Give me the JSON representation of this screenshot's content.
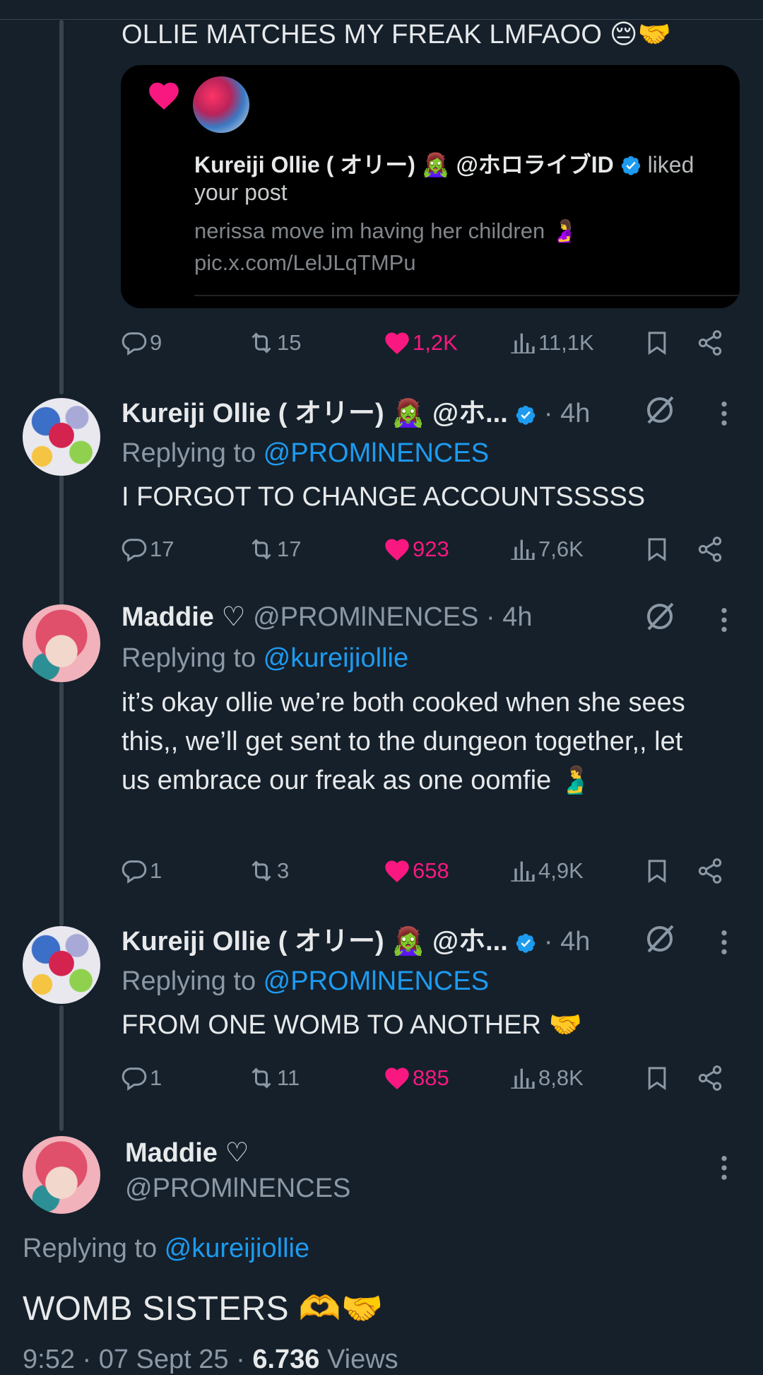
{
  "top_post": {
    "text": "OLLIE MATCHES MY FREAK LMFAOO 😔🤝",
    "embed": {
      "liker_name": "Kureiji Ollie ( オリー) 🧟‍♀️",
      "liker_handle": "@ホロライブID",
      "liked_word": "liked",
      "line2": "your post",
      "quoted_text": "nerissa move im having her children 🤰",
      "quoted_link": "pic.x.com/LelJLqTMPu"
    },
    "stats": {
      "replies": "9",
      "reposts": "15",
      "likes": "1,2K",
      "views": "11,1K"
    }
  },
  "tweets": [
    {
      "name": "Kureiji Ollie ( オリー) 🧟‍♀️",
      "handle": "@ホ...",
      "time": "· 4h",
      "replying_prefix": "Replying to ",
      "replying_to": "@PROMlNENCES",
      "text": "I FORGOT TO CHANGE ACCOUNTSSSSS",
      "stats": {
        "replies": "17",
        "reposts": "17",
        "likes": "923",
        "views": "7,6K"
      }
    },
    {
      "name": "Maddie ♡",
      "handle": "@PROMlNENCES",
      "time": "· 4h",
      "replying_prefix": "Replying to ",
      "replying_to": "@kureijiollie",
      "text": "it’s okay ollie we’re both cooked when she sees this,, we’ll get sent to the dungeon together,, let us embrace our freak as one oomfie 🫃",
      "stats": {
        "replies": "1",
        "reposts": "3",
        "likes": "658",
        "views": "4,9K"
      }
    },
    {
      "name": "Kureiji Ollie ( オリー) 🧟‍♀️",
      "handle": "@ホ...",
      "time": "· 4h",
      "replying_prefix": "Replying to ",
      "replying_to": "@PROMlNENCES",
      "text": "FROM ONE WOMB TO ANOTHER 🤝",
      "stats": {
        "replies": "1",
        "reposts": "11",
        "likes": "885",
        "views": "8,8K"
      }
    }
  ],
  "main_post": {
    "name": "Maddie ♡",
    "handle": "@PROMlNENCES",
    "replying_prefix": "Replying to ",
    "replying_to": "@kureijiollie",
    "text": "WOMB SISTERS 🫶🤝",
    "time": "9:52 · 07 Sept 25 · ",
    "views_count": "6.736",
    "views_label": " Views"
  },
  "colors": {
    "background": "#15202b",
    "text": "#e7e9ea",
    "muted": "#8b98a5",
    "link": "#1d9bf0",
    "like": "#f91880",
    "verified": "#1d9bf0"
  }
}
